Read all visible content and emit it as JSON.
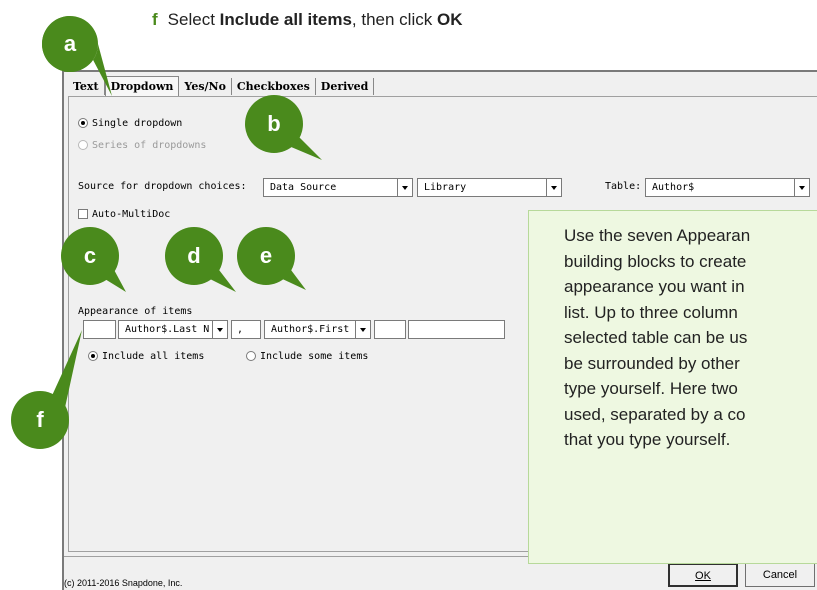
{
  "instruction": {
    "step": "f",
    "before": "Select ",
    "bold1": "Include all items",
    "middle": ", then click ",
    "bold2": "OK"
  },
  "tabs": [
    {
      "label": "Text",
      "active": false
    },
    {
      "label": "Dropdown",
      "active": true
    },
    {
      "label": "Yes/No",
      "active": false
    },
    {
      "label": "Checkboxes",
      "active": false
    },
    {
      "label": "Derived",
      "active": false
    }
  ],
  "dropdown_tab": {
    "single_dropdown": {
      "label": "Single dropdown",
      "selected": true
    },
    "series_dropdowns": {
      "label": "Series of dropdowns",
      "selected": false,
      "disabled": true
    },
    "source_label": "Source for dropdown choices:",
    "source_value": "Data Source",
    "library_value": "Library",
    "table_label": "Table:",
    "table_value": "Author$",
    "auto_multidoc": {
      "label": "Auto-MultiDoc",
      "checked": false
    },
    "appearance_label": "Appearance of items",
    "appearance": {
      "prefix": "",
      "column1": "Author$.Last N",
      "separator": ",",
      "column2": "Author$.First N",
      "suffix1": "",
      "suffix2": ""
    },
    "include_all": {
      "label": "Include all items",
      "selected": true
    },
    "include_some": {
      "label": "Include some items",
      "selected": false
    }
  },
  "footer": {
    "copyright": "(c) 2011-2016 Snapdone, Inc.",
    "ok_label": "OK",
    "cancel_label": "Cancel"
  },
  "callout_lines": [
    "Use the seven Appearan",
    "building blocks to create",
    "appearance you want in",
    "list. Up to three column",
    "selected table can be us",
    "be surrounded by other",
    "type yourself. Here two",
    "used, separated by a co",
    "that you type yourself."
  ],
  "markers": {
    "a": "a",
    "b": "b",
    "c": "c",
    "d": "d",
    "e": "e",
    "f": "f"
  },
  "colors": {
    "marker_green": "#4a8a1c",
    "callout_bg": "#eef8e1"
  }
}
